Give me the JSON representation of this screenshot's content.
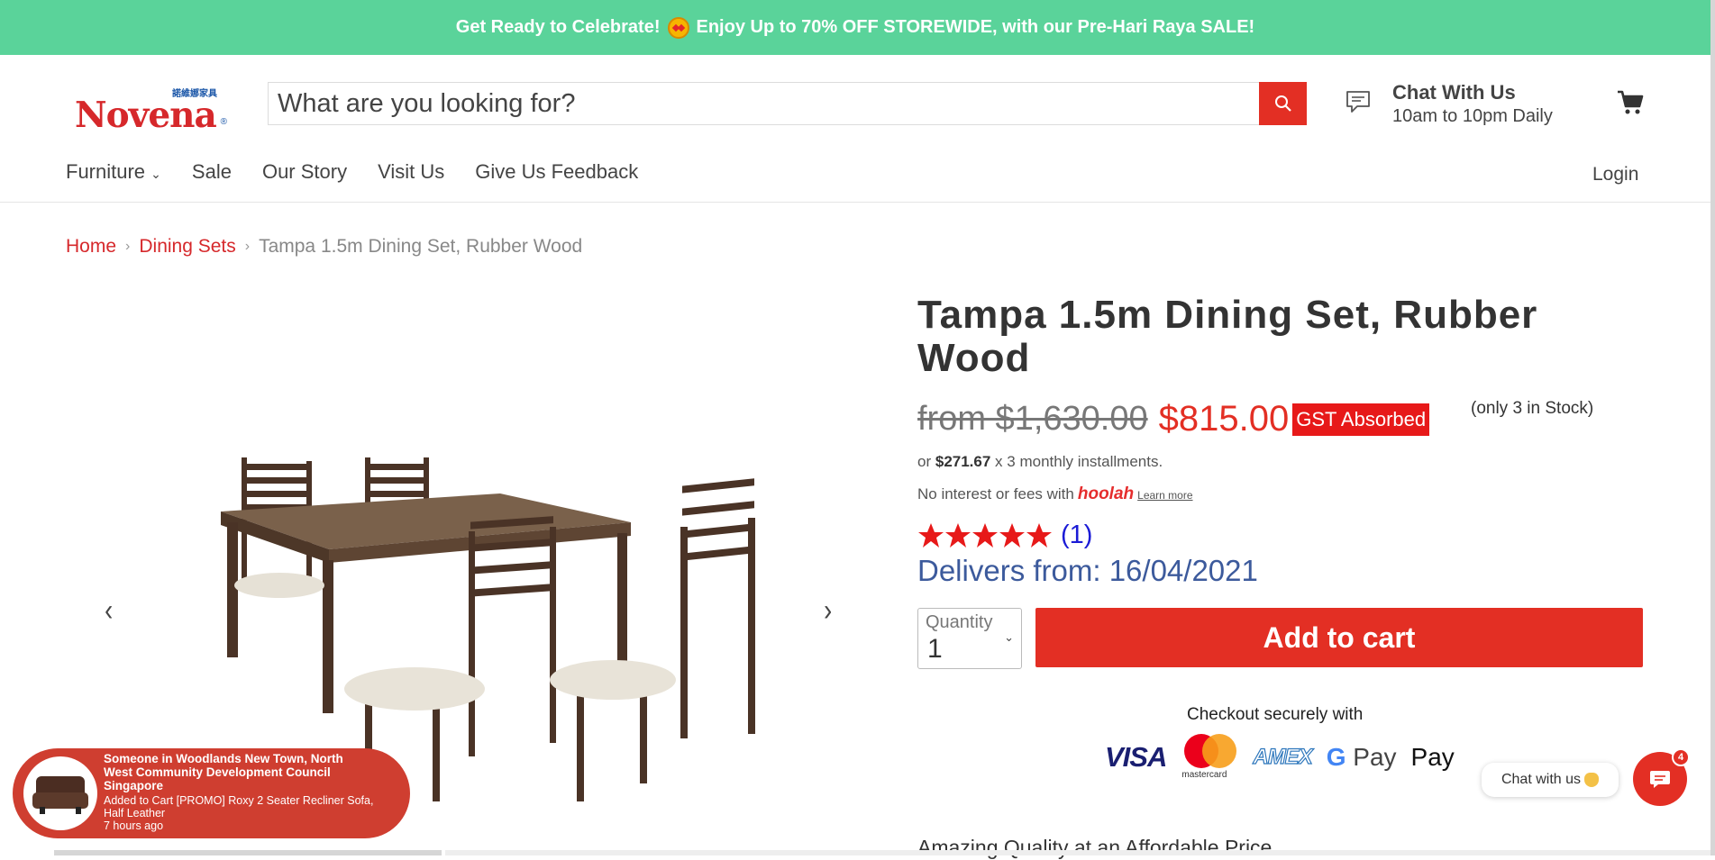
{
  "promo": {
    "text_before": "Get Ready to Celebrate!",
    "text_after": "Enjoy Up to 70% OFF STOREWIDE, with our Pre-Hari Raya SALE!"
  },
  "header": {
    "logo_text": "Novena",
    "logo_chinese": "諾維娜家具",
    "logo_reg": "®",
    "search_placeholder": "What are you looking for?",
    "chat_title": "Chat With Us",
    "chat_hours": "10am to 10pm Daily"
  },
  "nav": {
    "items": [
      "Furniture",
      "Sale",
      "Our Story",
      "Visit Us",
      "Give Us Feedback"
    ],
    "furniture_caret": "⌄",
    "login": "Login"
  },
  "breadcrumb": {
    "home": "Home",
    "category": "Dining Sets",
    "current": "Tampa 1.5m Dining Set, Rubber Wood",
    "separator": "›"
  },
  "gallery": {
    "prev": "‹",
    "next": "›"
  },
  "product": {
    "title": "Tampa 1.5m Dining Set, Rubber Wood",
    "old_price": "from $1,630.00",
    "price": "$815.00",
    "badge": "GST Absorbed",
    "stock": "(only 3 in Stock)",
    "installment_prefix": "or",
    "installment_amount": "$271.67",
    "installment_suffix": "x 3 monthly installments.",
    "interest_text": "No interest or fees with",
    "hoolah": "hoolah",
    "learn_more": "Learn more",
    "rating_stars": 5,
    "rating_count": "(1)",
    "delivery": "Delivers from: 16/04/2021",
    "quantity_label": "Quantity",
    "quantity_value": "1",
    "add_to_cart": "Add to cart",
    "checkout_text": "Checkout securely with",
    "amazing_heading": "Amazing Quality at an Affordable Price"
  },
  "payments": {
    "visa": "VISA",
    "mastercard": "mastercard",
    "amex": "AMEX",
    "gpay_g": "G",
    "gpay": "Pay",
    "applepay": "Pay"
  },
  "toast": {
    "title": "Someone in Woodlands New Town, North West Community Development Council Singapore",
    "detail": "Added to Cart [PROMO] Roxy 2 Seater Recliner Sofa, Half Leather",
    "time": "7 hours ago"
  },
  "chat_widget": {
    "bubble": "Chat with us",
    "badge": "4"
  },
  "colors": {
    "promo_bg": "#5ad39a",
    "accent_red": "#e32f24",
    "delivery_blue": "#3c5a9c",
    "rating_blue": "#1b1bd6"
  }
}
